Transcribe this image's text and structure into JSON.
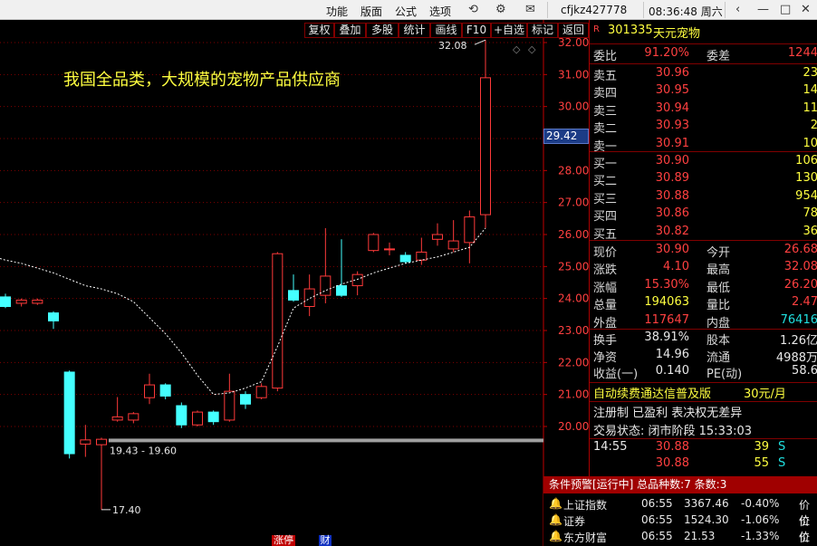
{
  "menu": [
    "功能",
    "版面",
    "公式",
    "选项"
  ],
  "account": "cfjkz427778",
  "clock": "08:36:48 周六",
  "toolbar": [
    "复权",
    "叠加",
    "多股",
    "统计",
    "画线",
    "F10",
    "+自选",
    "标记",
    "返回"
  ],
  "headline": "我国全品类，大规模的宠物产品供应商",
  "axis_tag": "29.42",
  "chart_data": {
    "type": "candlestick",
    "y_ticks": [
      32.0,
      31.0,
      30.0,
      29.0,
      28.0,
      27.0,
      26.0,
      25.0,
      24.0,
      23.0,
      22.0,
      21.0,
      20.0
    ],
    "ylim": [
      19.7,
      32.6
    ],
    "annotations": {
      "high_label": "32.08",
      "low_label": "17.40",
      "range_label": "19.43 - 19.60"
    },
    "candles": [
      {
        "o": 24.05,
        "c": 23.75,
        "h": 24.15,
        "l": 23.7
      },
      {
        "o": 23.85,
        "c": 23.95,
        "h": 24.0,
        "l": 23.75
      },
      {
        "o": 23.85,
        "c": 23.95,
        "h": 24.0,
        "l": 23.8
      },
      {
        "o": 23.55,
        "c": 23.3,
        "h": 23.6,
        "l": 23.05
      },
      {
        "o": 21.7,
        "c": 19.15,
        "h": 21.75,
        "l": 19.0
      },
      {
        "o": 19.45,
        "c": 19.58,
        "h": 20.05,
        "l": 19.05
      },
      {
        "o": 19.43,
        "c": 19.6,
        "h": 19.65,
        "l": 17.4
      },
      {
        "o": 20.2,
        "c": 20.3,
        "h": 20.92,
        "l": 20.15
      },
      {
        "o": 20.2,
        "c": 20.4,
        "h": 20.45,
        "l": 20.1
      },
      {
        "o": 20.9,
        "c": 21.3,
        "h": 21.65,
        "l": 20.7
      },
      {
        "o": 21.3,
        "c": 20.95,
        "h": 21.35,
        "l": 20.85
      },
      {
        "o": 20.65,
        "c": 20.05,
        "h": 20.75,
        "l": 19.95
      },
      {
        "o": 20.05,
        "c": 20.45,
        "h": 20.5,
        "l": 20.0
      },
      {
        "o": 20.45,
        "c": 20.15,
        "h": 20.5,
        "l": 20.05
      },
      {
        "o": 20.2,
        "c": 21.1,
        "h": 21.65,
        "l": 20.15
      },
      {
        "o": 21.0,
        "c": 20.7,
        "h": 21.1,
        "l": 20.55
      },
      {
        "o": 20.9,
        "c": 21.25,
        "h": 21.35,
        "l": 20.85
      },
      {
        "o": 21.2,
        "c": 25.4,
        "h": 25.45,
        "l": 21.1
      },
      {
        "o": 24.25,
        "c": 23.95,
        "h": 24.75,
        "l": 23.9
      },
      {
        "o": 23.75,
        "c": 24.3,
        "h": 24.75,
        "l": 23.45
      },
      {
        "o": 24.1,
        "c": 24.7,
        "h": 26.2,
        "l": 23.85
      },
      {
        "o": 24.4,
        "c": 24.1,
        "h": 25.85,
        "l": 24.05
      },
      {
        "o": 24.4,
        "c": 24.75,
        "h": 24.85,
        "l": 24.1
      },
      {
        "o": 25.5,
        "c": 26.0,
        "h": 26.05,
        "l": 25.45
      },
      {
        "o": 25.55,
        "c": 25.55,
        "h": 25.75,
        "l": 25.35
      },
      {
        "o": 25.35,
        "c": 25.15,
        "h": 25.45,
        "l": 25.1
      },
      {
        "o": 25.2,
        "c": 25.45,
        "h": 25.9,
        "l": 25.05
      },
      {
        "o": 25.85,
        "c": 26.0,
        "h": 26.35,
        "l": 25.65
      },
      {
        "o": 25.55,
        "c": 25.8,
        "h": 26.45,
        "l": 25.45
      },
      {
        "o": 25.75,
        "c": 26.55,
        "h": 26.75,
        "l": 25.1
      },
      {
        "o": 26.62,
        "c": 30.9,
        "h": 32.08,
        "l": 26.2
      }
    ],
    "ma": [
      25.2,
      25.1,
      24.95,
      24.8,
      24.6,
      24.4,
      24.3,
      24.15,
      23.9,
      23.4,
      22.9,
      22.3,
      21.6,
      21.0,
      21.05,
      21.2,
      21.4,
      22.5,
      23.7,
      24.0,
      24.25,
      24.45,
      24.6,
      24.8,
      24.95,
      25.1,
      25.2,
      25.3,
      25.45,
      25.6,
      26.2
    ]
  },
  "panel": {
    "code": "301335",
    "name": "天元宠物",
    "ratio_row": {
      "label": "委比",
      "value": "91.20%",
      "label2": "委差",
      "value2": "1244"
    },
    "asks": [
      {
        "label": "卖五",
        "price": "30.96",
        "vol": "23"
      },
      {
        "label": "卖四",
        "price": "30.95",
        "vol": "14"
      },
      {
        "label": "卖三",
        "price": "30.94",
        "vol": "11"
      },
      {
        "label": "卖二",
        "price": "30.93",
        "vol": "2"
      },
      {
        "label": "卖一",
        "price": "30.91",
        "vol": "10"
      }
    ],
    "bids": [
      {
        "label": "买一",
        "price": "30.90",
        "vol": "106"
      },
      {
        "label": "买二",
        "price": "30.89",
        "vol": "130"
      },
      {
        "label": "买三",
        "price": "30.88",
        "vol": "954"
      },
      {
        "label": "买四",
        "price": "30.86",
        "vol": "78"
      },
      {
        "label": "买五",
        "price": "30.82",
        "vol": "36"
      }
    ],
    "stats": [
      {
        "l1": "现价",
        "v1": "30.90",
        "l2": "今开",
        "v2": "26.68",
        "c1": "red",
        "c2": "red"
      },
      {
        "l1": "涨跌",
        "v1": "4.10",
        "l2": "最高",
        "v2": "32.08",
        "c1": "red",
        "c2": "red"
      },
      {
        "l1": "涨幅",
        "v1": "15.30%",
        "l2": "最低",
        "v2": "26.20",
        "c1": "red",
        "c2": "red"
      },
      {
        "l1": "总量",
        "v1": "194063",
        "l2": "量比",
        "v2": "2.47",
        "c1": "ylw",
        "c2": "red"
      },
      {
        "l1": "外盘",
        "v1": "117647",
        "l2": "内盘",
        "v2": "76416",
        "c1": "red",
        "c2": "grn"
      }
    ],
    "stats2": [
      {
        "l1": "换手",
        "v1": "38.91%",
        "l2": "股本",
        "v2": "1.26亿"
      },
      {
        "l1": "净资",
        "v1": "14.96",
        "l2": "流通",
        "v2": "4988万"
      },
      {
        "l1": "收益(一)",
        "v1": "0.140",
        "l2": "PE(动)",
        "v2": "58.6"
      }
    ],
    "promo": "自动续费通达信普及版",
    "promo_price": "30元/月",
    "status_line": "注册制 已盈利 表决权无差异",
    "trade_state": "交易状态: 闭市阶段 15:33:03",
    "ticks": [
      {
        "time": "14:55",
        "price": "30.88",
        "vol": "39",
        "side": "S"
      },
      {
        "time": "",
        "price": "30.88",
        "vol": "55",
        "side": "S"
      }
    ]
  },
  "alerts": {
    "header": "条件预警[运行中] 总品种数:7 条数:3",
    "rows": [
      {
        "name": "上证指数",
        "time": "06:55",
        "value": "3367.46",
        "change": "-0.40%",
        "note": "价位"
      },
      {
        "name": "证券",
        "time": "06:55",
        "value": "1524.30",
        "change": "-1.06%",
        "note": "价位"
      },
      {
        "name": "东方财富",
        "time": "06:55",
        "value": "21.53",
        "change": "-1.33%",
        "note": "价位"
      }
    ]
  },
  "bottom_tags": [
    "涨停",
    "财"
  ]
}
